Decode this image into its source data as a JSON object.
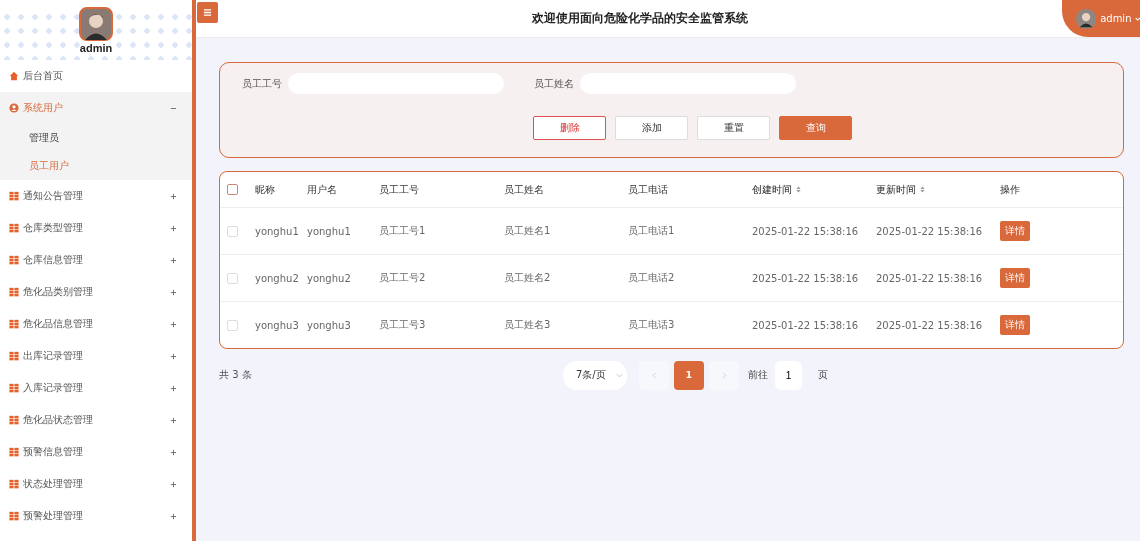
{
  "sidebar": {
    "user": "admin",
    "menu": [
      {
        "kind": "home",
        "label": "后台首页",
        "expanded": false,
        "selected": false
      },
      {
        "kind": "group",
        "label": "系统用户",
        "expanded": true,
        "selected": true,
        "children": [
          {
            "label": "管理员",
            "selected": false
          },
          {
            "label": "员工用户",
            "selected": true
          }
        ]
      },
      {
        "kind": "group",
        "label": "通知公告管理",
        "expanded": false,
        "selected": false
      },
      {
        "kind": "group",
        "label": "仓库类型管理",
        "expanded": false,
        "selected": false
      },
      {
        "kind": "group",
        "label": "仓库信息管理",
        "expanded": false,
        "selected": false
      },
      {
        "kind": "group",
        "label": "危化品类别管理",
        "expanded": false,
        "selected": false
      },
      {
        "kind": "group",
        "label": "危化品信息管理",
        "expanded": false,
        "selected": false
      },
      {
        "kind": "group",
        "label": "出库记录管理",
        "expanded": false,
        "selected": false
      },
      {
        "kind": "group",
        "label": "入库记录管理",
        "expanded": false,
        "selected": false
      },
      {
        "kind": "group",
        "label": "危化品状态管理",
        "expanded": false,
        "selected": false
      },
      {
        "kind": "group",
        "label": "预警信息管理",
        "expanded": false,
        "selected": false
      },
      {
        "kind": "group",
        "label": "状态处理管理",
        "expanded": false,
        "selected": false
      },
      {
        "kind": "group",
        "label": "预警处理管理",
        "expanded": false,
        "selected": false
      }
    ]
  },
  "header": {
    "title": "欢迎使用面向危险化学品的安全监管系统",
    "user": "admin"
  },
  "search": {
    "fields": [
      {
        "label": "员工工号"
      },
      {
        "label": "员工姓名"
      }
    ],
    "buttons": [
      {
        "label": "删除",
        "kind": "danger"
      },
      {
        "label": "添加",
        "kind": "plain"
      },
      {
        "label": "重置",
        "kind": "plain"
      },
      {
        "label": "查询",
        "kind": "primary"
      }
    ]
  },
  "table": {
    "all_checked": false,
    "columns": [
      {
        "label": "昵称",
        "sortable": false
      },
      {
        "label": "用户名",
        "sortable": false
      },
      {
        "label": "员工工号",
        "sortable": false
      },
      {
        "label": "员工姓名",
        "sortable": false
      },
      {
        "label": "员工电话",
        "sortable": false
      },
      {
        "label": "创建时间",
        "sortable": true
      },
      {
        "label": "更新时间",
        "sortable": true
      },
      {
        "label": "操作",
        "sortable": false
      }
    ],
    "rows": [
      {
        "checked": false,
        "cells": [
          "yonghu1",
          "yonghu1",
          "员工工号1",
          "员工姓名1",
          "员工电话1",
          "2025-01-22 15:38:16",
          "2025-01-22 15:38:16"
        ],
        "action": "详情"
      },
      {
        "checked": false,
        "cells": [
          "yonghu2",
          "yonghu2",
          "员工工号2",
          "员工姓名2",
          "员工电话2",
          "2025-01-22 15:38:16",
          "2025-01-22 15:38:16"
        ],
        "action": "详情"
      },
      {
        "checked": false,
        "cells": [
          "yonghu3",
          "yonghu3",
          "员工工号3",
          "员工姓名3",
          "员工电话3",
          "2025-01-22 15:38:16",
          "2025-01-22 15:38:16"
        ],
        "action": "详情"
      }
    ]
  },
  "pagination": {
    "total": "共 3 条",
    "page_size": "7条/页",
    "pages": [
      {
        "label": "1",
        "selected": true
      }
    ],
    "goto_label": "前往",
    "goto_value": "1",
    "goto_unit": "页"
  }
}
